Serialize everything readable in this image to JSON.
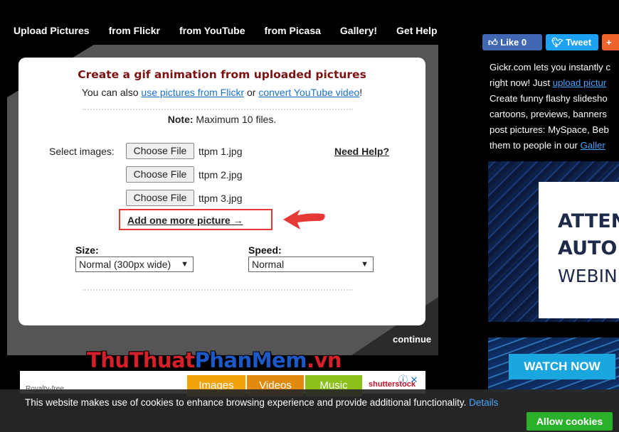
{
  "nav": [
    "Upload Pictures",
    "from Flickr",
    "from YouTube",
    "from Picasa",
    "Gallery!",
    "Get Help"
  ],
  "form": {
    "title": "Create a gif animation from uploaded pictures",
    "sub_prefix": "You can also",
    "sub_link1": "use pictures from Flickr",
    "sub_or": "or",
    "sub_link2": "convert YouTube video",
    "sub_suffix": "!",
    "note_bold": "Note:",
    "note_text": "Maximum 10 files.",
    "select_label": "Select images:",
    "need_help": "Need Help?",
    "files": [
      {
        "button": "Choose File",
        "name": "ttpm 1.jpg"
      },
      {
        "button": "Choose File",
        "name": "ttpm 2.jpg"
      },
      {
        "button": "Choose File",
        "name": "ttpm 3.jpg"
      }
    ],
    "add_more": "Add one more picture →",
    "size_label": "Size:",
    "size_value": "Normal (300px wide)",
    "speed_label": "Speed:",
    "speed_value": "Normal",
    "continue": "continue",
    "annotation_color": "#e53935"
  },
  "social": {
    "like": "Like 0",
    "tweet": "Tweet",
    "plus": "+"
  },
  "sidebar": {
    "l1": "Gickr.com lets you instantly c",
    "l2_prefix": "right now! Just",
    "l2_link": "upload pictur",
    "l3": "Create funny flashy slidesho",
    "l4": "cartoons, previews, banners",
    "l5": "post pictures: MySpace, Beb",
    "l6_prefix": "them to people in our",
    "l6_link": "Galler"
  },
  "ad": {
    "t1": "ATTEN",
    "t2": "AUTO",
    "t3": "WEBIN",
    "watch": "WATCH NOW"
  },
  "banner": {
    "watermark_a": "ThuThuat",
    "watermark_b": "PhanMem",
    "watermark_c": ".vn",
    "images": "Images",
    "videos": "Videos",
    "music": "Music",
    "brand": "shutterstock",
    "close": "ⓘ ✕",
    "small": "Royalty-free"
  },
  "cookie": {
    "text": "This website makes use of cookies to enhance browsing experience and provide additional functionality.",
    "details": "Details",
    "allow": "Allow cookies"
  }
}
